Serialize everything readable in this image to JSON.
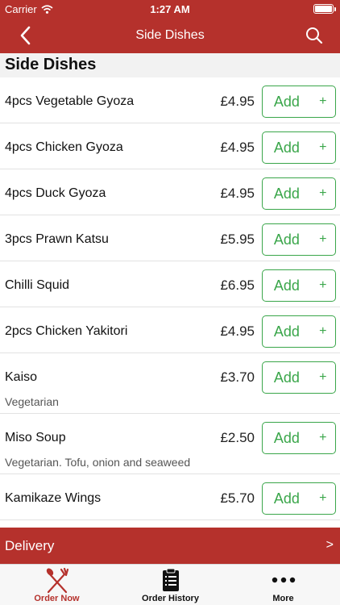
{
  "status_bar": {
    "carrier": "Carrier",
    "time": "1:27 AM"
  },
  "nav": {
    "title": "Side Dishes"
  },
  "section": {
    "title": "Side Dishes"
  },
  "items": [
    {
      "name": "4pcs Vegetable Gyoza",
      "price": "£4.95",
      "add_label": "Add",
      "plus_label": "+"
    },
    {
      "name": "4pcs Chicken Gyoza",
      "price": "£4.95",
      "add_label": "Add",
      "plus_label": "+"
    },
    {
      "name": "4pcs Duck Gyoza",
      "price": "£4.95",
      "add_label": "Add",
      "plus_label": "+"
    },
    {
      "name": "3pcs Prawn Katsu",
      "price": "£5.95",
      "add_label": "Add",
      "plus_label": "+"
    },
    {
      "name": "Chilli Squid",
      "price": "£6.95",
      "add_label": "Add",
      "plus_label": "+"
    },
    {
      "name": "2pcs Chicken Yakitori",
      "price": "£4.95",
      "add_label": "Add",
      "plus_label": "+"
    },
    {
      "name": "Kaiso",
      "price": "£3.70",
      "description": "Vegetarian",
      "add_label": "Add",
      "plus_label": "+"
    },
    {
      "name": "Miso Soup",
      "price": "£2.50",
      "description": "Vegetarian. Tofu, onion and seaweed",
      "add_label": "Add",
      "plus_label": "+"
    },
    {
      "name": "Kamikaze Wings",
      "price": "£5.70",
      "add_label": "Add",
      "plus_label": "+"
    }
  ],
  "delivery": {
    "label": "Delivery",
    "arrow": ">"
  },
  "tabs": [
    {
      "label": "Order Now",
      "icon": "fork-knife-icon",
      "active": true
    },
    {
      "label": "Order History",
      "icon": "clipboard-icon",
      "active": false
    },
    {
      "label": "More",
      "icon": "more-dots-icon",
      "active": false
    }
  ],
  "colors": {
    "brand": "#b5312c",
    "accent_green": "#3aa64a"
  }
}
